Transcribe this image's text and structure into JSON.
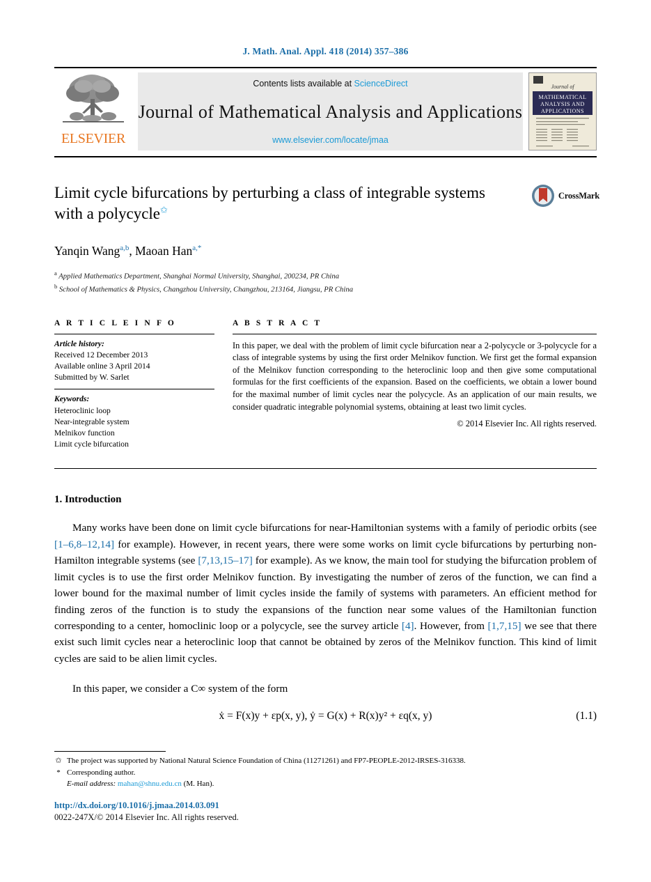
{
  "running_head": "J. Math. Anal. Appl. 418 (2014) 357–386",
  "masthead": {
    "elsevier_wordmark": "ELSEVIER",
    "contents_prefix": "Contents lists available at ",
    "sciencedirect": "ScienceDirect",
    "journal_title": "Journal of Mathematical Analysis and Applications",
    "journal_url": "www.elsevier.com/locate/jmaa",
    "cover_line1": "Journal of",
    "cover_line2": "MATHEMATICAL",
    "cover_line3": "ANALYSIS AND",
    "cover_line4": "APPLICATIONS"
  },
  "article": {
    "title": "Limit cycle bifurcations by perturbing a class of integrable systems with a polycycle",
    "title_footnote_mark": "✩",
    "authors": [
      {
        "name": "Yanqin Wang",
        "marks": "a,b"
      },
      {
        "name": "Maoan Han",
        "marks": "a,*"
      }
    ],
    "authors_separator": ", ",
    "affiliations": [
      {
        "mark": "a",
        "text": "Applied Mathematics Department, Shanghai Normal University, Shanghai, 200234, PR China"
      },
      {
        "mark": "b",
        "text": "School of Mathematics & Physics, Changzhou University, Changzhou, 213164, Jiangsu, PR China"
      }
    ],
    "crossmark_label": "CrossMark"
  },
  "info": {
    "heading": "A R T I C L E   I N F O",
    "history_heading": "Article history:",
    "history": [
      "Received 12 December 2013",
      "Available online 3 April 2014",
      "Submitted by W. Sarlet"
    ],
    "keywords_heading": "Keywords:",
    "keywords": [
      "Heteroclinic loop",
      "Near-integrable system",
      "Melnikov function",
      "Limit cycle bifurcation"
    ]
  },
  "abstract": {
    "heading": "A B S T R A C T",
    "text": "In this paper, we deal with the problem of limit cycle bifurcation near a 2-polycycle or 3-polycycle for a class of integrable systems by using the first order Melnikov function. We first get the formal expansion of the Melnikov function corresponding to the heteroclinic loop and then give some computational formulas for the first coefficients of the expansion. Based on the coefficients, we obtain a lower bound for the maximal number of limit cycles near the polycycle. As an application of our main results, we consider quadratic integrable polynomial systems, obtaining at least two limit cycles.",
    "copyright": "© 2014 Elsevier Inc. All rights reserved."
  },
  "body": {
    "section_number_title": "1. Introduction",
    "para1_a": "Many works have been done on limit cycle bifurcations for near-Hamiltonian systems with a family of periodic orbits (see ",
    "cite1": "[1–6,8–12,14]",
    "para1_b": " for example). However, in recent years, there were some works on limit cycle bifurcations by perturbing non-Hamilton integrable systems (see ",
    "cite2": "[7,13,15–17]",
    "para1_c": " for example). As we know, the main tool for studying the bifurcation problem of limit cycles is to use the first order Melnikov function. By investigating the number of zeros of the function, we can find a lower bound for the maximal number of limit cycles inside the family of systems with parameters. An efficient method for finding zeros of the function is to study the expansions of the function near some values of the Hamiltonian function corresponding to a center, homoclinic loop or a polycycle, see the survey article ",
    "cite3": "[4]",
    "para1_d": ". However, from ",
    "cite4": "[1,7,15]",
    "para1_e": " we see that there exist such limit cycles near a heteroclinic loop that cannot be obtained by zeros of the Melnikov function. This kind of limit cycles are said to be alien limit cycles.",
    "para2": "In this paper, we consider a C∞ system of the form",
    "equation": "ẋ = F(x)y + εp(x, y),      ẏ = G(x) + R(x)y² + εq(x, y)",
    "equation_number": "(1.1)"
  },
  "footnotes": {
    "star_mark": "✩",
    "star_text": "The project was supported by National Natural Science Foundation of China (11271261) and FP7-PEOPLE-2012-IRSES-316338.",
    "corresponding_mark": "*",
    "corresponding_text": "Corresponding author.",
    "email_label": "E-mail address:",
    "email": "mahan@shnu.edu.cn",
    "email_suffix": "(M. Han)."
  },
  "footer": {
    "doi": "http://dx.doi.org/10.1016/j.jmaa.2014.03.091",
    "issn_line": "0022-247X/© 2014 Elsevier Inc. All rights reserved."
  },
  "colors": {
    "link_blue": "#1b9ad6",
    "cite_blue": "#1b6ea8",
    "elsevier_orange": "#E87722",
    "cover_navy": "#2b2b54",
    "crossmark_red": "#c0392b"
  }
}
